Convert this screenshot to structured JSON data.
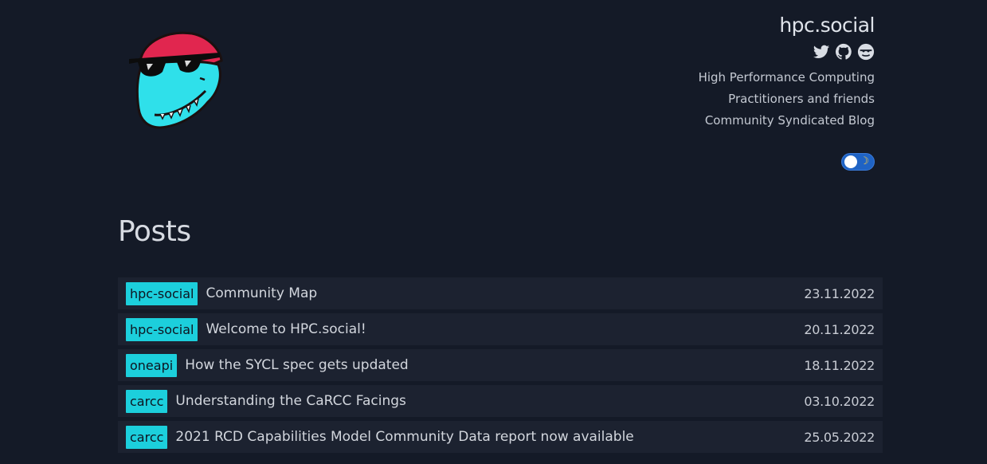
{
  "site": {
    "title": "hpc.social",
    "taglines": [
      "High Performance Computing",
      "Practitioners and friends",
      "Community Syndicated Blog"
    ],
    "social_icons": [
      "twitter-icon",
      "github-icon",
      "mastodon-icon"
    ],
    "theme_toggle": {
      "state": "dark",
      "icon": "moon-icon"
    }
  },
  "colors": {
    "background": "#141a27",
    "row_background": "#1c2230",
    "tag_background": "#1ccfdc",
    "toggle_accent": "#1f63c4"
  },
  "posts": {
    "heading": "Posts",
    "items": [
      {
        "tag": "hpc-social",
        "title": "Community Map",
        "date": "23.11.2022"
      },
      {
        "tag": "hpc-social",
        "title": "Welcome to HPC.social!",
        "date": "20.11.2022"
      },
      {
        "tag": "oneapi",
        "title": "How the SYCL spec gets updated",
        "date": "18.11.2022"
      },
      {
        "tag": "carcc",
        "title": "Understanding the CaRCC Facings",
        "date": "03.10.2022"
      },
      {
        "tag": "carcc",
        "title": "2021 RCD Capabilities Model Community Data report now available",
        "date": "25.05.2022"
      }
    ]
  }
}
